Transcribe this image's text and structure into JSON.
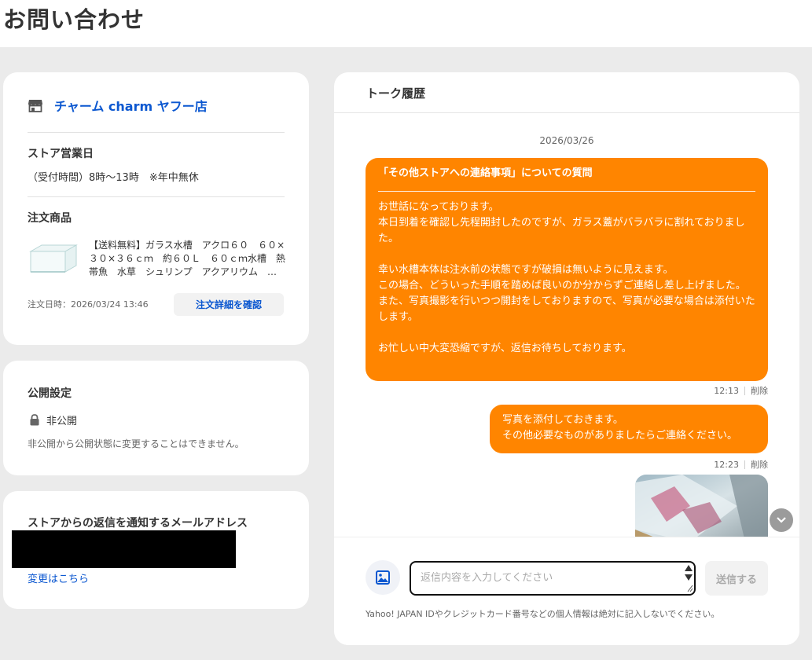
{
  "page": {
    "title": "お問い合わせ"
  },
  "store": {
    "name": "チャーム charm ヤフー店",
    "business_days_title": "ストア営業日",
    "business_hours": "（受付時間）8時～13時　※年中無休",
    "order_title": "注文商品",
    "product_name": "【送料無料】ガラス水槽　アクロ６０　６０×３０×３６ｃｍ　約６０Ｌ　６０ｃｍ水槽　熱帯魚　水草　シュリンプ　アクアリウム　…",
    "order_date": "注文日時：2026/03/24 13:46",
    "order_detail_button": "注文詳細を確認"
  },
  "visibility": {
    "title": "公開設定",
    "status": "非公開",
    "note": "非公開から公開状態に変更することはできません。"
  },
  "mail": {
    "title": "ストアからの返信を通知するメールアドレス",
    "change_link": "変更はこちら"
  },
  "talk": {
    "title": "トーク履歴",
    "date": "2026/03/26",
    "messages": [
      {
        "subject": "「その他ストアへの連絡事項」についての質問",
        "body": "お世話になっております。\n本日到着を確認し先程開封したのですが、ガラス蓋がバラバラに割れておりました。\n\n幸い水槽本体は注水前の状態ですが破損は無いように見えます。\nこの場合、どういった手順を踏めば良いのか分からずご連絡し差し上げました。\nまた、写真撮影を行いつつ開封をしておりますので、写真が必要な場合は添付いたします。\n\nお忙しい中大変恐縮ですが、返信お待ちしております。",
        "time": "12:13",
        "delete_label": "削除"
      },
      {
        "body": "写真を添付しておきます。\nその他必要なものがありましたらご連絡ください。",
        "time": "12:23",
        "delete_label": "削除"
      }
    ]
  },
  "compose": {
    "placeholder": "返信内容を入力してください",
    "send_label": "送信する",
    "privacy_note": "Yahoo! JAPAN IDやクレジットカード番号などの個人情報は絶対に記入しないでください。"
  },
  "colors": {
    "accent_orange": "#ff8500",
    "link_blue": "#0b57d0",
    "background": "#ebebeb"
  },
  "icons": {
    "store": "store-icon",
    "lock": "lock-icon",
    "image": "image-icon",
    "scroll_down": "chevron-down-icon"
  }
}
